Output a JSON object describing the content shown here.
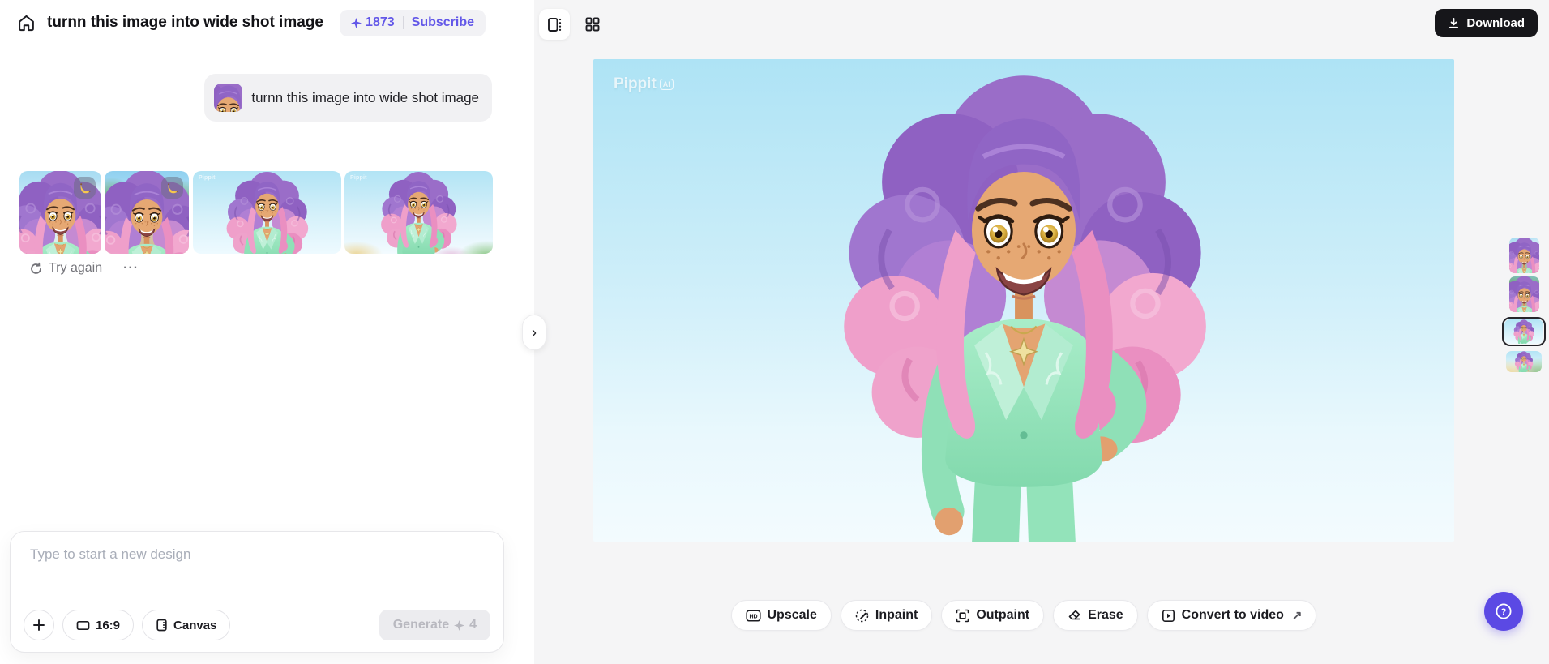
{
  "colors": {
    "accent": "#6257e8",
    "help_fab": "#5b49e4",
    "download_bg": "#16161a",
    "panel_bg": "#f5f5f6"
  },
  "header": {
    "title": "turnn this image into wide shot image",
    "credits": "1873",
    "subscribe_label": "Subscribe"
  },
  "chat": {
    "message": "turnn this image into wide shot image",
    "try_again_label": "Try again",
    "more_glyph": "···"
  },
  "results": {
    "count": "4",
    "model_badge_icon": "banana-icon"
  },
  "composer": {
    "placeholder": "Type to start a new design",
    "add_icon": "plus-icon",
    "ratio_label": "16:9",
    "canvas_label": "Canvas",
    "generate_label": "Generate",
    "generate_cost": "4"
  },
  "viewer": {
    "watermark": "Pippit",
    "watermark_badge": "AI",
    "download_label": "Download",
    "expand_glyph": "›",
    "external_glyph": "↗",
    "actions": [
      {
        "label": "Upscale",
        "icon": "hd-icon"
      },
      {
        "label": "Inpaint",
        "icon": "inpaint-brush-icon"
      },
      {
        "label": "Outpaint",
        "icon": "outpaint-expand-icon"
      },
      {
        "label": "Erase",
        "icon": "eraser-icon"
      },
      {
        "label": "Convert to video",
        "icon": "video-icon"
      }
    ]
  }
}
